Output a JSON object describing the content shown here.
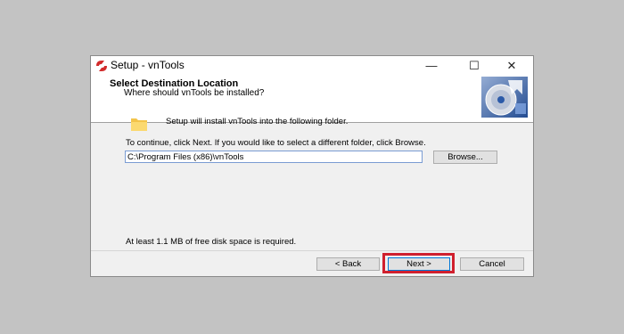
{
  "window": {
    "title": "Setup - vnTools",
    "controls": {
      "minimize": "—",
      "maximize": "☐",
      "close": "✕"
    },
    "icon": "setup-app-icon"
  },
  "header": {
    "title": "Select Destination Location",
    "subtitle": "Where should vnTools be installed?",
    "image": "wizard-cd-image"
  },
  "body": {
    "folder_icon": "folder-icon",
    "intro": "Setup will install vnTools into the following folder.",
    "instructions": "To continue, click Next. If you would like to select a different folder, click Browse.",
    "path_value": "C:\\Program Files (x86)\\vnTools",
    "browse_label": "Browse...",
    "space_required": "At least 1.1 MB of free disk space is required."
  },
  "footer": {
    "back_label": "< Back",
    "next_label": "Next >",
    "cancel_label": "Cancel"
  },
  "colors": {
    "highlight": "#d0202e",
    "focus_border": "#0078d7",
    "background": "#c3c3c3"
  }
}
